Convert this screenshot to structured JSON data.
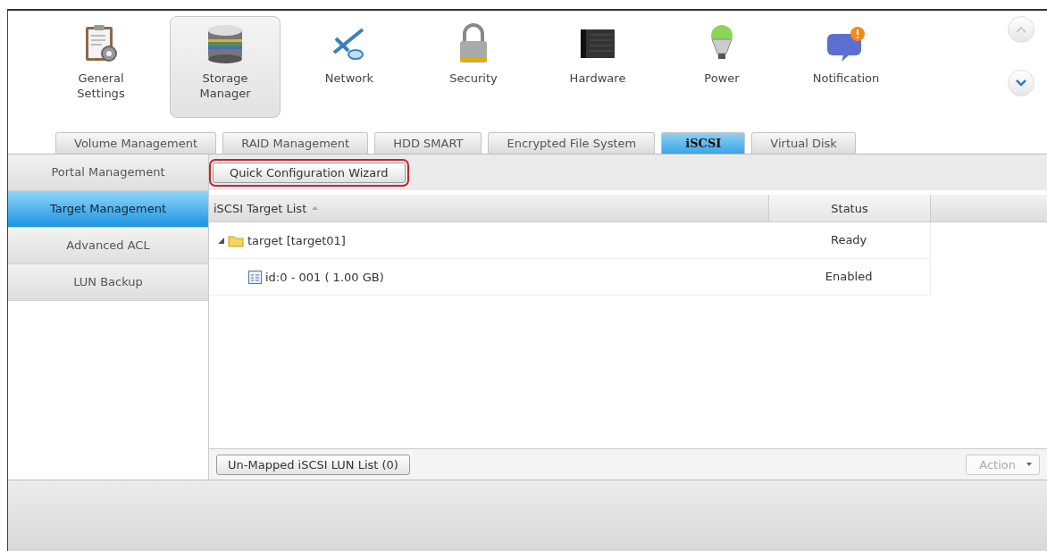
{
  "categories": [
    {
      "label": "General\nSettings",
      "kind": "clipboard",
      "selected": false
    },
    {
      "label": "Storage\nManager",
      "kind": "disks",
      "selected": true
    },
    {
      "label": "Network",
      "kind": "network",
      "selected": false
    },
    {
      "label": "Security",
      "kind": "lock",
      "selected": false
    },
    {
      "label": "Hardware",
      "kind": "server",
      "selected": false
    },
    {
      "label": "Power",
      "kind": "bulb",
      "selected": false
    },
    {
      "label": "Notification",
      "kind": "bubble",
      "selected": false
    }
  ],
  "tabs": [
    {
      "label": "Volume Management",
      "selected": false
    },
    {
      "label": "RAID Management",
      "selected": false
    },
    {
      "label": "HDD SMART",
      "selected": false
    },
    {
      "label": "Encrypted File System",
      "selected": false
    },
    {
      "label": "iSCSI",
      "selected": true
    },
    {
      "label": "Virtual Disk",
      "selected": false
    }
  ],
  "sidebar": {
    "items": [
      {
        "label": "Portal Management",
        "selected": false
      },
      {
        "label": "Target Management",
        "selected": true
      },
      {
        "label": "Advanced ACL",
        "selected": false
      },
      {
        "label": "LUN Backup",
        "selected": false
      }
    ]
  },
  "toolbar": {
    "wizard_button": {
      "label": "Quick Configuration Wizard",
      "highlighted": true
    }
  },
  "table": {
    "columns": [
      "iSCSI Target List",
      "Status"
    ],
    "rows": [
      {
        "kind": "target",
        "name": "target [target01]",
        "status": "Ready",
        "expanded": true,
        "children": [
          {
            "kind": "lun",
            "name": "id:0 - 001 ( 1.00 GB)",
            "status": "Enabled"
          }
        ]
      }
    ]
  },
  "bottom_bar": {
    "unmapped_button": "Un-Mapped iSCSI LUN List (0)",
    "action_button": {
      "label": "Action",
      "disabled": true
    }
  }
}
